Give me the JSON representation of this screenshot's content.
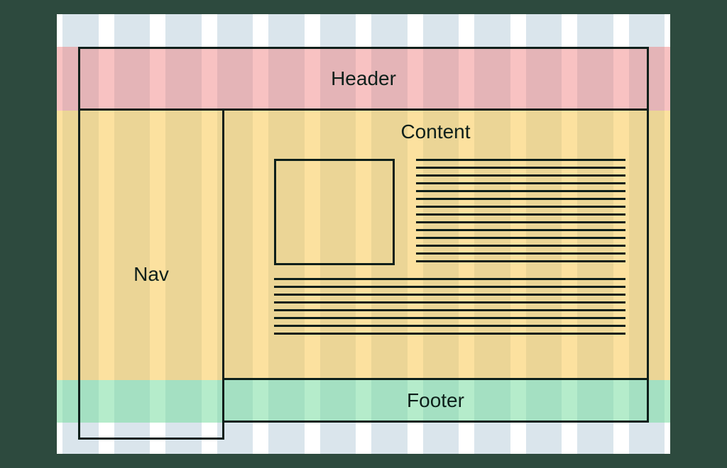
{
  "diagram": {
    "type": "layout-wireframe",
    "columns": 12,
    "regions": {
      "header": {
        "label": "Header",
        "row_band": "red"
      },
      "nav": {
        "label": "Nav",
        "row_band": "orange"
      },
      "content": {
        "label": "Content",
        "row_band": "orange"
      },
      "footer": {
        "label": "Footer",
        "row_band": "green"
      }
    },
    "colors": {
      "background": "#2d4a3e",
      "canvas": "#ffffff",
      "column_stripe": "rgba(150,180,200,0.35)",
      "header_band": "rgba(240,120,120,0.45)",
      "body_band": "rgba(250,200,80,0.55)",
      "footer_band": "rgba(120,220,160,0.55)",
      "stroke": "#0d1f1a"
    }
  }
}
